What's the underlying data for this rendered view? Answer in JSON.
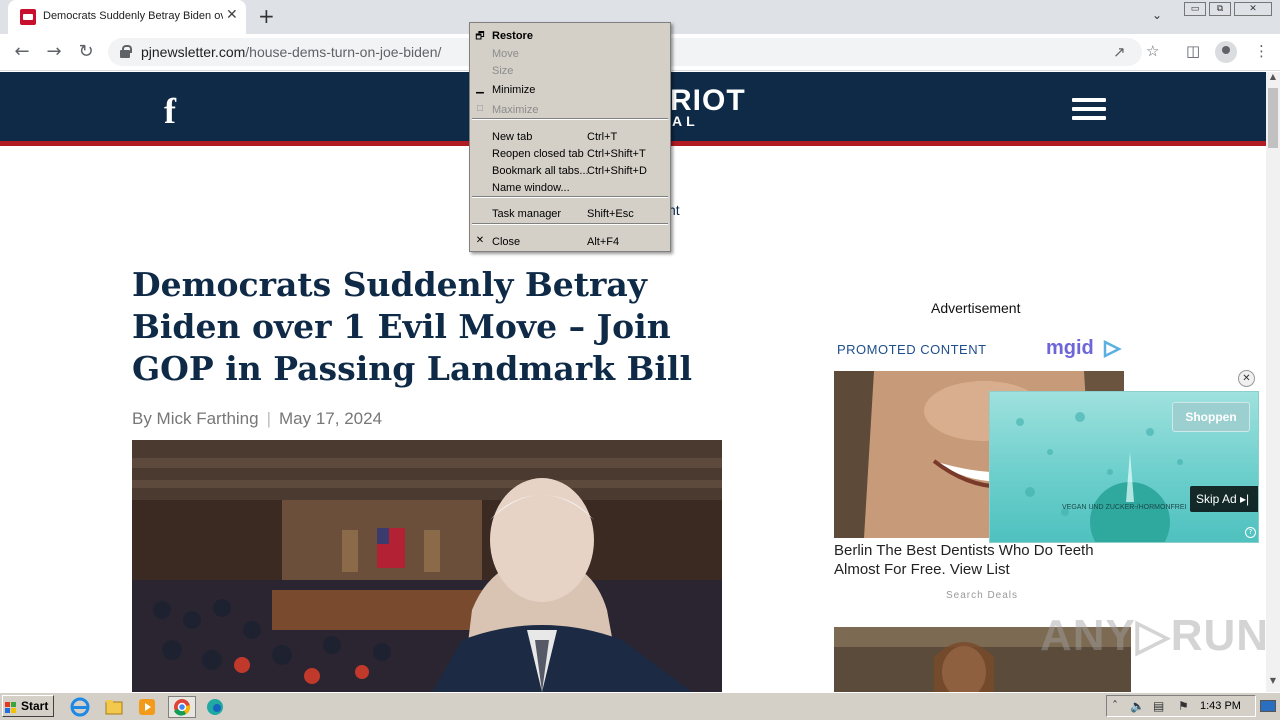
{
  "browser": {
    "tab_title": "Democrats Suddenly Betray Biden ov",
    "tab_close": "✕",
    "new_tab": "+",
    "url_host": "pjnewsletter.com",
    "url_path": "/house-dems-turn-on-joe-biden/",
    "window_controls": [
      "▭",
      "⧉",
      "✕"
    ]
  },
  "site": {
    "facebook_glyph": "f",
    "logo_text": "RIOT",
    "logo_sub": "AL",
    "ad_label_partial": "nt"
  },
  "article": {
    "headline": "Democrats Suddenly Betray Biden over 1 Evil Move – Join GOP in Passing Landmark Bill",
    "author": "By Mick Farthing",
    "separator": "|",
    "date": "May 17, 2024"
  },
  "sidebar": {
    "advertisement": "Advertisement",
    "promoted": "PROMOTED CONTENT",
    "mgid": "mgid",
    "promo1_text": "Berlin The Best Dentists Who Do Teeth Almost For Free. View List",
    "promo1_source": "Search Deals"
  },
  "video_ad": {
    "close": "✕",
    "shop_button": "Shoppen",
    "skip": "Skip Ad ▸|",
    "fine_print": "VEGAN UND ZUCKER-/HORMONFREI",
    "help": "?"
  },
  "watermark": "ANY▷RUN",
  "system_menu": {
    "items": [
      {
        "icon": "🗗",
        "label": "Restore",
        "key": "",
        "disabled": false,
        "bold": true
      },
      {
        "icon": "",
        "label": "Move",
        "key": "",
        "disabled": true,
        "bold": false
      },
      {
        "icon": "",
        "label": "Size",
        "key": "",
        "disabled": true,
        "bold": false
      },
      {
        "icon": "▁",
        "label": "Minimize",
        "key": "",
        "disabled": false,
        "bold": false
      },
      {
        "icon": "□",
        "label": "Maximize",
        "key": "",
        "disabled": true,
        "bold": false
      },
      {
        "icon": "",
        "label": "New tab",
        "key": "Ctrl+T",
        "disabled": false,
        "bold": false
      },
      {
        "icon": "",
        "label": "Reopen closed tab",
        "key": "Ctrl+Shift+T",
        "disabled": false,
        "bold": false
      },
      {
        "icon": "",
        "label": "Bookmark all tabs...",
        "key": "Ctrl+Shift+D",
        "disabled": false,
        "bold": false
      },
      {
        "icon": "",
        "label": "Name window...",
        "key": "",
        "disabled": false,
        "bold": false
      },
      {
        "icon": "",
        "label": "Task manager",
        "key": "Shift+Esc",
        "disabled": false,
        "bold": false
      },
      {
        "icon": "✕",
        "label": "Close",
        "key": "Alt+F4",
        "disabled": false,
        "bold": false
      }
    ]
  },
  "taskbar": {
    "start": "Start",
    "clock": "1:43 PM"
  }
}
